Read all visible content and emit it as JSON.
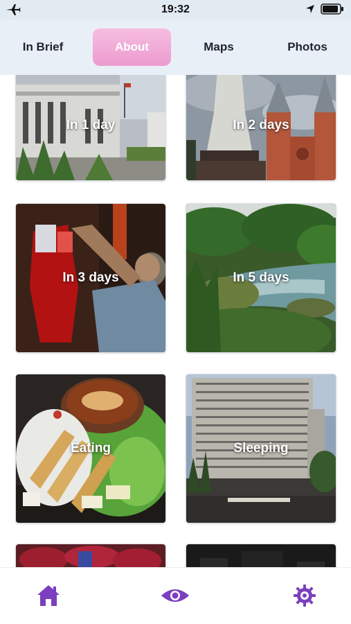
{
  "status_bar": {
    "time": "19:32",
    "left_icon": "airplane-icon",
    "right_icons": [
      "location-arrow-icon",
      "battery-icon"
    ]
  },
  "tabs": [
    {
      "label": "In Brief",
      "active": false
    },
    {
      "label": "About",
      "active": true
    },
    {
      "label": "Maps",
      "active": false
    },
    {
      "label": "Photos",
      "active": false
    }
  ],
  "tiles": [
    {
      "label": "In 1 day"
    },
    {
      "label": "In 2 days"
    },
    {
      "label": "In 3 days"
    },
    {
      "label": "In 5 days"
    },
    {
      "label": "Eating"
    },
    {
      "label": "Sleeping"
    }
  ],
  "bottom_bar": {
    "icons": [
      "home-icon",
      "eye-icon",
      "gear-icon"
    ],
    "accent_color": "#7b3fbf"
  },
  "colors": {
    "active_tab": "#f0a8d6",
    "tab_bar_bg": "#e9eff6"
  }
}
